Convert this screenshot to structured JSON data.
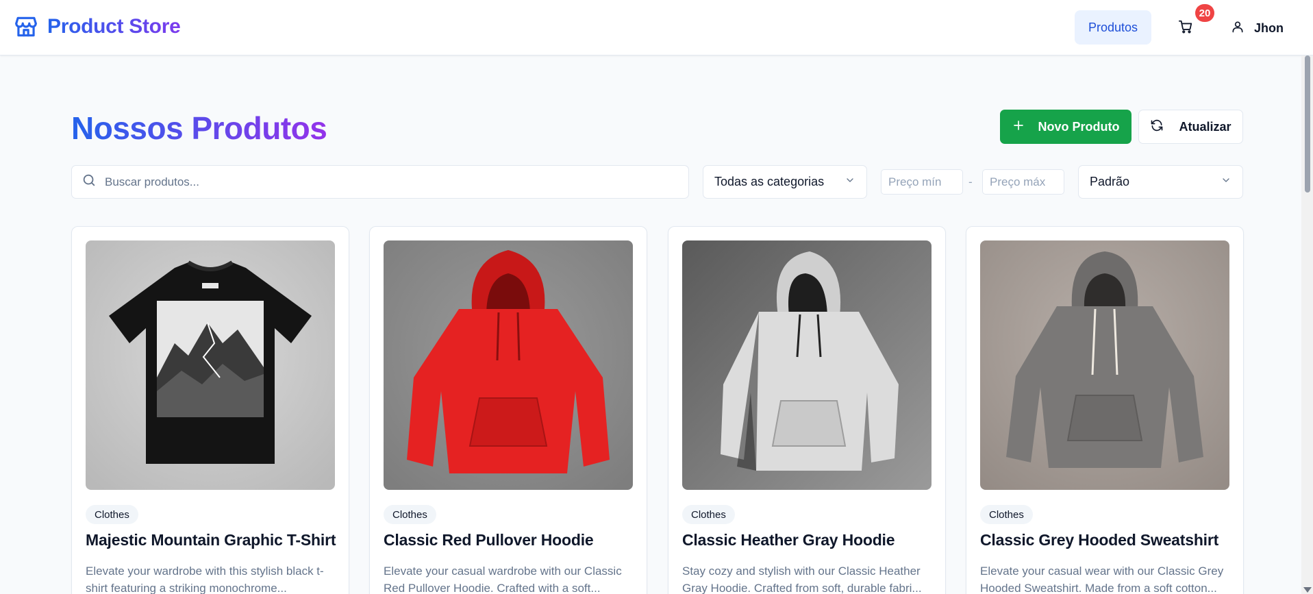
{
  "header": {
    "brand": "Product Store",
    "nav_produtos": "Produtos",
    "cart_count": "20",
    "user_name": "Jhon"
  },
  "page": {
    "title": "Nossos Produtos",
    "new_button": "Novo Produto",
    "refresh_button": "Atualizar"
  },
  "filters": {
    "search_placeholder": "Buscar produtos...",
    "category_value": "Todas as categorias",
    "price_min_placeholder": "Preço mín",
    "price_separator": "-",
    "price_max_placeholder": "Preço máx",
    "sort_value": "Padrão"
  },
  "products": [
    {
      "category": "Clothes",
      "title": "Majestic Mountain Graphic T-Shirt",
      "description": "Elevate your wardrobe with this stylish black t-shirt featuring a striking monochrome..."
    },
    {
      "category": "Clothes",
      "title": "Classic Red Pullover Hoodie",
      "description": "Elevate your casual wardrobe with our Classic Red Pullover Hoodie. Crafted with a soft..."
    },
    {
      "category": "Clothes",
      "title": "Classic Heather Gray Hoodie",
      "description": "Stay cozy and stylish with our Classic Heather Gray Hoodie. Crafted from soft, durable fabri..."
    },
    {
      "category": "Clothes",
      "title": "Classic Grey Hooded Sweatshirt",
      "description": "Elevate your casual wear with our Classic Grey Hooded Sweatshirt. Made from a soft cotton..."
    }
  ],
  "colors": {
    "brand_gradient_start": "#2563eb",
    "brand_gradient_end": "#7c3aed",
    "new_button": "#16a34a",
    "cart_badge": "#ef4444",
    "nav_active_bg": "#eaf2ff"
  }
}
